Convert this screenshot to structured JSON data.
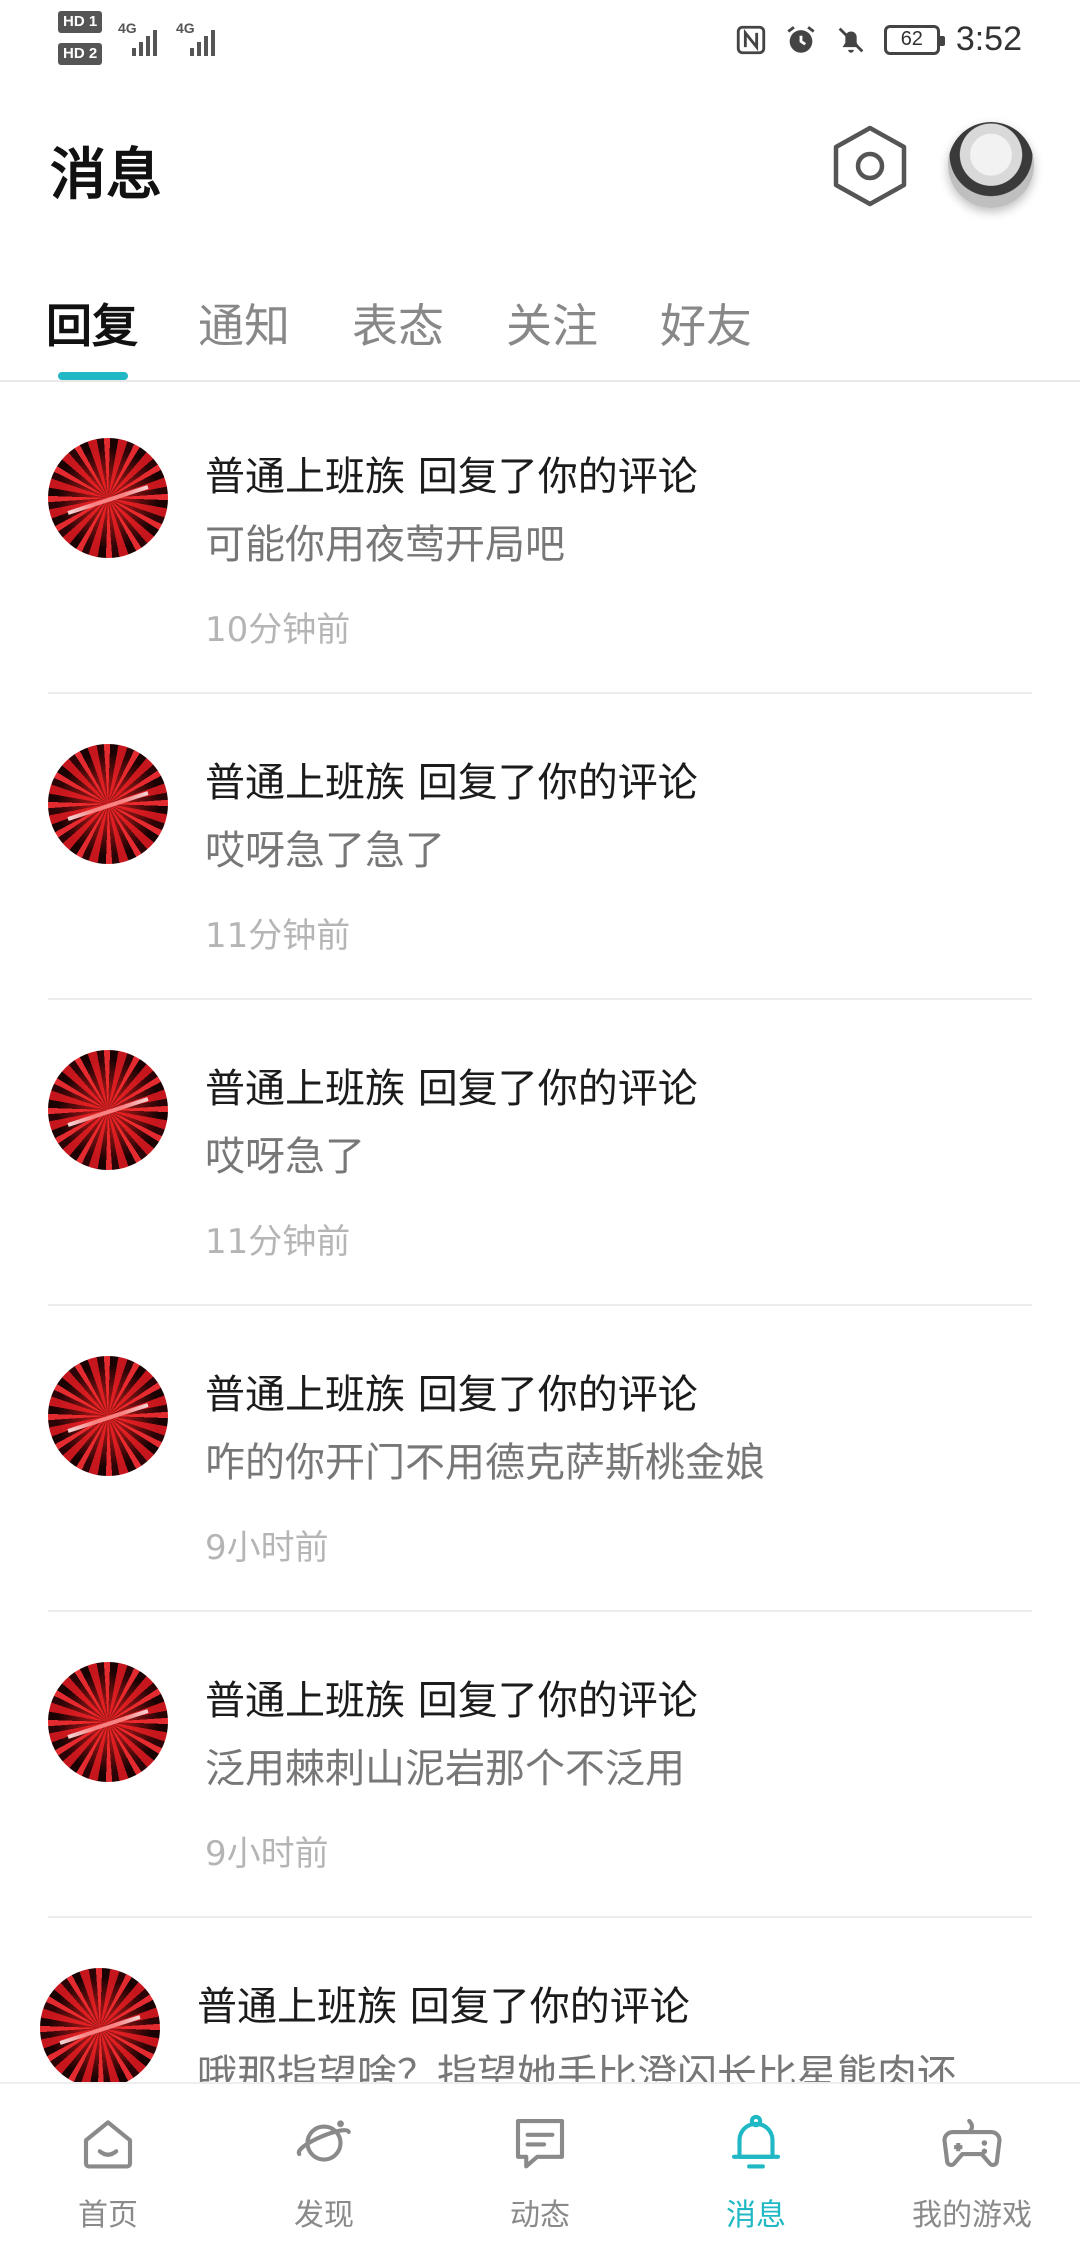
{
  "status_bar": {
    "hd1": "HD 1",
    "hd2": "HD 2",
    "net1": "4G",
    "net2": "4G",
    "battery": "62",
    "time": "3:52",
    "icons": [
      "nfc-icon",
      "alarm-icon",
      "mute-icon",
      "battery-icon"
    ]
  },
  "header": {
    "title": "消息",
    "settings_icon": "hexagon-settings-icon",
    "avatar": "user-avatar"
  },
  "tabs": {
    "items": [
      {
        "label": "回复",
        "active": true
      },
      {
        "label": "通知",
        "active": false
      },
      {
        "label": "表态",
        "active": false
      },
      {
        "label": "关注",
        "active": false
      },
      {
        "label": "好友",
        "active": false
      }
    ],
    "accent_color": "#1fb8c4"
  },
  "messages": [
    {
      "title": "普通上班族 回复了你的评论",
      "content": "可能你用夜莺开局吧",
      "time": "10分钟前"
    },
    {
      "title": "普通上班族 回复了你的评论",
      "content": "哎呀急了急了",
      "time": "11分钟前"
    },
    {
      "title": "普通上班族 回复了你的评论",
      "content": "哎呀急了",
      "time": "11分钟前"
    },
    {
      "title": "普通上班族 回复了你的评论",
      "content": "咋的你开门不用德克萨斯桃金娘",
      "time": "9小时前"
    },
    {
      "title": "普通上班族 回复了你的评论",
      "content": "泛用棘刺山泥岩那个不泛用",
      "time": "9小时前"
    },
    {
      "title": "普通上班族 回复了你的评论",
      "content": "哦那指望啥？指望她手比澄闪长比星熊肉还",
      "time": ""
    }
  ],
  "bottom_nav": {
    "items": [
      {
        "label": "首页",
        "icon": "home-icon",
        "active": false
      },
      {
        "label": "发现",
        "icon": "planet-icon",
        "active": false
      },
      {
        "label": "动态",
        "icon": "feed-icon",
        "active": false
      },
      {
        "label": "消息",
        "icon": "bell-icon",
        "active": true
      },
      {
        "label": "我的游戏",
        "icon": "gamepad-icon",
        "active": false
      }
    ],
    "active_color": "#1fb8c4",
    "inactive_color": "#8a8a8a"
  }
}
